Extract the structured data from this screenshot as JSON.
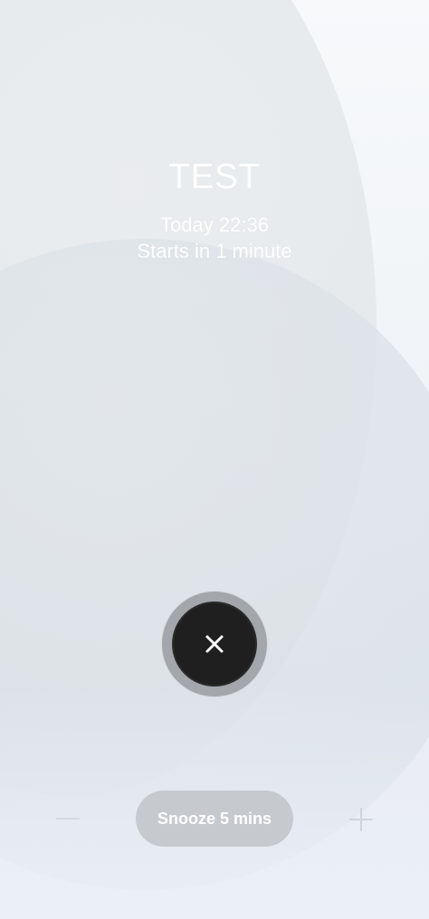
{
  "alarm": {
    "title": "TEST",
    "time": "Today 22:36",
    "starts": "Starts in 1 minute"
  },
  "actions": {
    "dismiss_icon": "close-icon",
    "snooze_label": "Snooze 5 mins",
    "decrease_icon": "minus-icon",
    "increase_icon": "plus-icon"
  },
  "colors": {
    "dismiss_button": "#1f1f1f",
    "dismiss_ring": "#a3a7ab",
    "snooze_button": "#c6cacf",
    "text": "#ffffff"
  }
}
